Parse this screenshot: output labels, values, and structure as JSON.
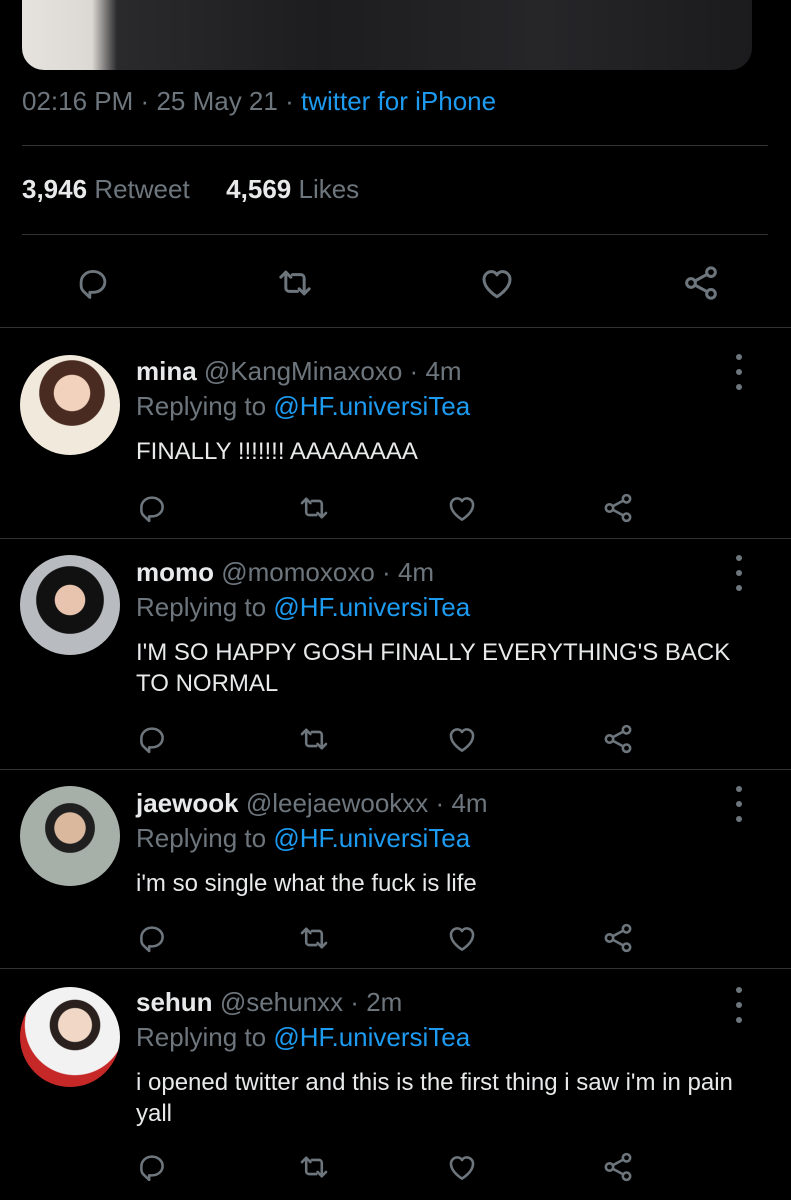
{
  "tweet": {
    "time": "02:16 PM",
    "date": "25 May 21",
    "source": "twitter for iPhone",
    "retweet_count": "3,946",
    "retweet_label": "Retweet",
    "like_count": "4,569",
    "like_label": "Likes",
    "separator": "·"
  },
  "replies": [
    {
      "name": "mina",
      "handle": "@KangMinaxoxo",
      "age": "4m",
      "replying_prefix": "Replying to",
      "replying_to": "@HF.universiTea",
      "text": "FINALLY !!!!!!! AAAAAAAA"
    },
    {
      "name": "momo",
      "handle": "@momoxoxo",
      "age": "4m",
      "replying_prefix": "Replying to",
      "replying_to": "@HF.universiTea",
      "text": "I'M SO HAPPY GOSH FINALLY EVERYTHING'S BACK TO NORMAL"
    },
    {
      "name": "jaewook",
      "handle": "@leejaewookxx",
      "age": "4m",
      "replying_prefix": "Replying to",
      "replying_to": "@HF.universiTea",
      "text": "i'm so single what the fuck is life"
    },
    {
      "name": "sehun",
      "handle": "@sehunxx",
      "age": "2m",
      "replying_prefix": "Replying to",
      "replying_to": "@HF.universiTea",
      "text": "i opened twitter and this is the first thing i saw i'm in pain yall"
    }
  ],
  "icons": {
    "reply": "reply-icon",
    "retweet": "retweet-icon",
    "like": "heart-icon",
    "share": "share-icon",
    "more": "more-icon"
  },
  "colors": {
    "background": "#000000",
    "text": "#e7e9ea",
    "muted": "#6e767d",
    "accent": "#1d9bf0",
    "divider": "#2f3336"
  }
}
